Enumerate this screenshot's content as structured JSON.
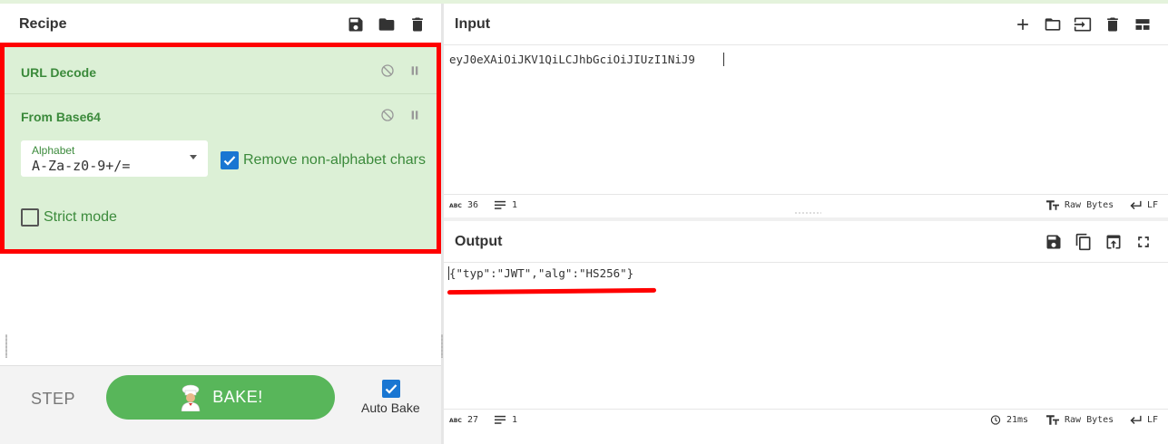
{
  "recipe": {
    "title": "Recipe",
    "header_icons": [
      "save-icon",
      "folder-icon",
      "trash-icon"
    ],
    "operations": [
      {
        "name": "URL Decode"
      },
      {
        "name": "From Base64",
        "alphabet_label": "Alphabet",
        "alphabet_value": "A-Za-z0-9+/=",
        "remove_non_alphabet_label": "Remove non-alphabet chars",
        "remove_non_alphabet_checked": true,
        "strict_mode_label": "Strict mode",
        "strict_mode_checked": false
      }
    ],
    "step_label": "STEP",
    "bake_label": "BAKE!",
    "auto_bake_label": "Auto Bake",
    "auto_bake_checked": true
  },
  "input": {
    "title": "Input",
    "header_icons": [
      "plus-icon",
      "folder-icon",
      "import-icon",
      "trash-icon",
      "layout-icon"
    ],
    "text": "eyJ0eXAiOiJKV1QiLCJhbGciOiJIUzI1NiJ9",
    "status": {
      "chars": "36",
      "lines": "1",
      "encoding": "Raw Bytes",
      "eol": "LF"
    }
  },
  "output": {
    "title": "Output",
    "header_icons": [
      "save-icon",
      "copy-icon",
      "replace-input-icon",
      "fullscreen-icon"
    ],
    "text": "{\"typ\":\"JWT\",\"alg\":\"HS256\"}",
    "status": {
      "chars": "27",
      "lines": "1",
      "time": "21ms",
      "encoding": "Raw Bytes",
      "eol": "LF"
    }
  },
  "colors": {
    "highlight_red": "#ff0000",
    "recipe_bg": "#dcf0d6",
    "bake_green": "#58b65a",
    "checkbox_blue": "#1976d2"
  }
}
